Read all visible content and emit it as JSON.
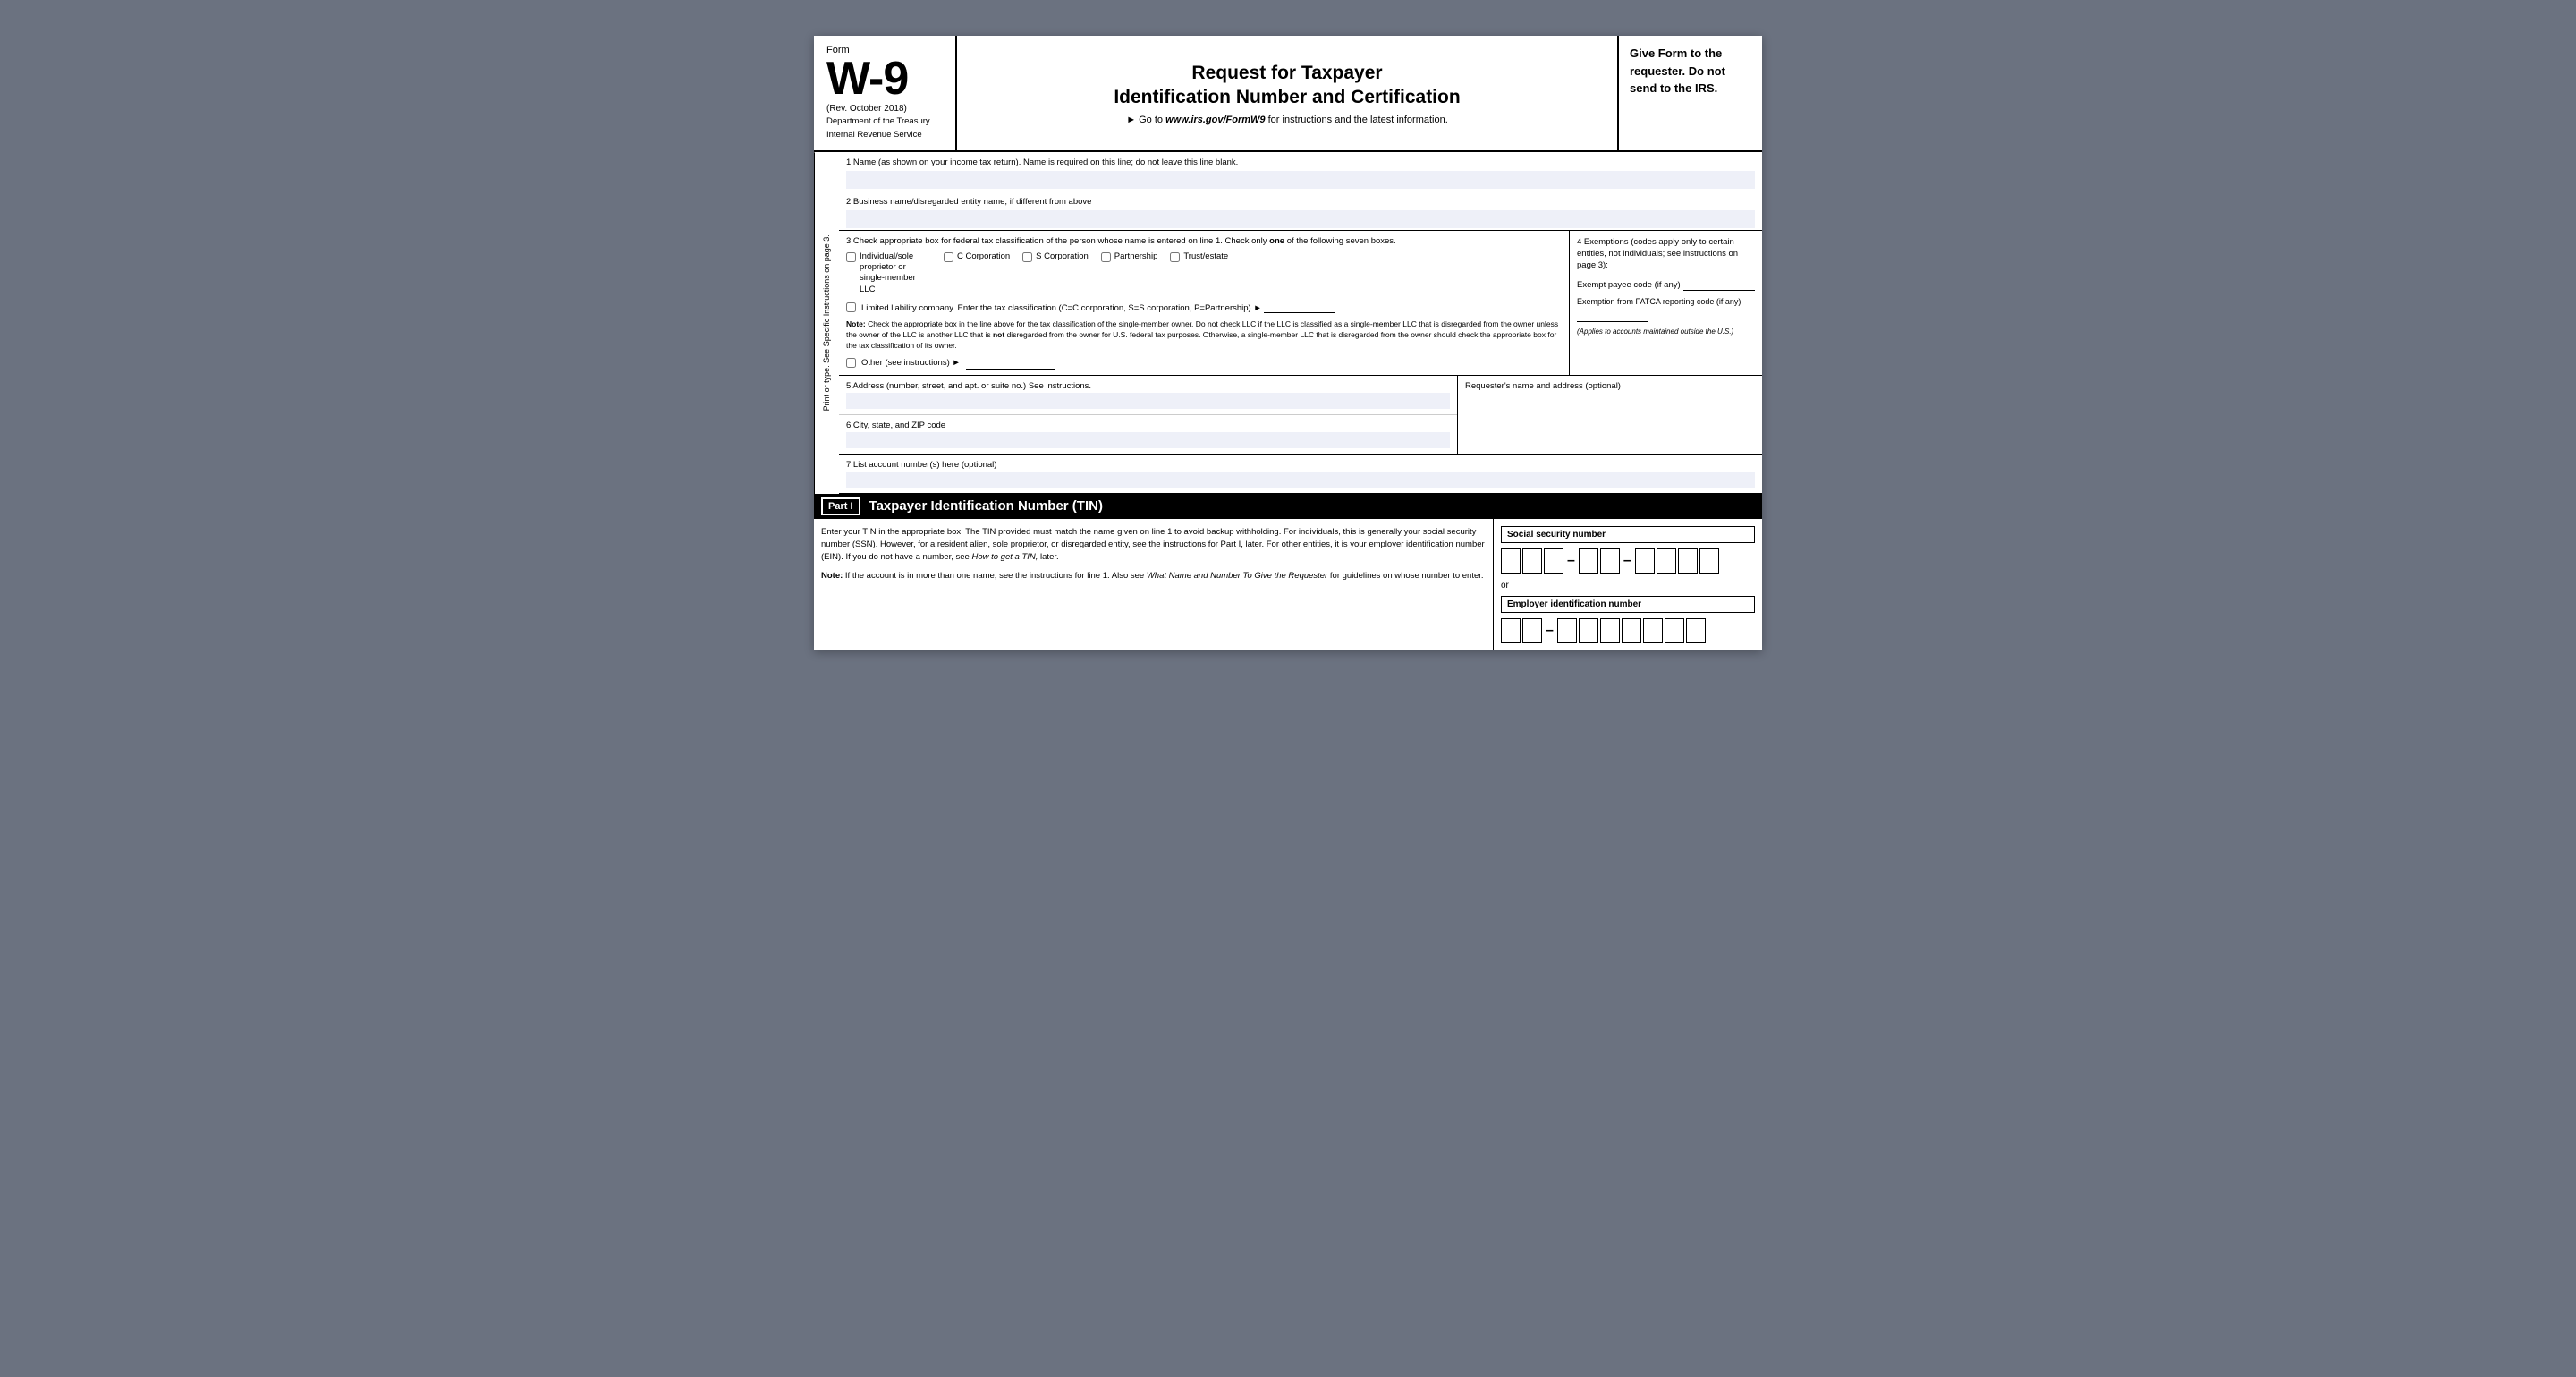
{
  "header": {
    "form_label": "Form",
    "form_number": "W-9",
    "rev": "(Rev. October 2018)",
    "dept1": "Department of the Treasury",
    "dept2": "Internal Revenue Service",
    "title_line1": "Request for Taxpayer",
    "title_line2": "Identification Number and Certification",
    "goto_text": "► Go to",
    "goto_url": "www.irs.gov/FormW9",
    "goto_suffix": "for instructions and the latest information.",
    "right_text_line1": "Give Form to the",
    "right_text_line2": "requester. Do not",
    "right_text_line3": "send to the IRS."
  },
  "sidebar": {
    "text": "Print or type.     See Specific Instructions on page 3."
  },
  "fields": {
    "field1_label": "1  Name (as shown on your income tax return). Name is required on this line; do not leave this line blank.",
    "field2_label": "2  Business name/disregarded entity name, if different from above",
    "field3_label": "3  Check appropriate box for federal tax classification of the person whose name is entered on line 1. Check only",
    "field3_label_bold": "one",
    "field3_label_end": "of the following seven boxes.",
    "check_individual": "Individual/sole proprietor or single-member LLC",
    "check_c_corp": "C Corporation",
    "check_s_corp": "S Corporation",
    "check_partnership": "Partnership",
    "check_trust": "Trust/estate",
    "llc_text1": "Limited liability company. Enter the tax classification (C=C corporation, S=S corporation, P=Partnership) ►",
    "note_label": "Note:",
    "note_text": " Check the appropriate box in the line above for the tax classification of the single-member owner.  Do not check LLC if the LLC is classified as a single-member LLC that is disregarded from the owner unless the owner of the LLC is another LLC that is",
    "note_not": "not",
    "note_text2": " disregarded from the owner for U.S. federal tax purposes. Otherwise, a single-member LLC that is disregarded from the owner should check the appropriate box for the tax classification of its owner.",
    "check_other": "Other (see instructions) ►",
    "exemptions_title": "4  Exemptions (codes apply only to certain entities, not individuals; see instructions on page 3):",
    "exempt_payee_label": "Exempt payee code (if any)",
    "fatca_label": "Exemption from FATCA reporting code (if any)",
    "applies_text": "(Applies to accounts maintained outside the U.S.)",
    "field5_label": "5  Address (number, street, and apt. or suite no.) See instructions.",
    "requester_label": "Requester's name and address (optional)",
    "field6_label": "6  City, state, and ZIP code",
    "field7_label": "7  List account number(s) here (optional)"
  },
  "part1": {
    "label": "Part I",
    "title": "Taxpayer Identification Number (TIN)",
    "body1": "Enter your TIN in the appropriate box. The TIN provided must match the name given on line 1 to avoid backup withholding. For individuals, this is generally your social security number (SSN). However, for a resident alien, sole proprietor, or disregarded entity, see the instructions for Part I, later. For other entities, it is your employer identification number (EIN). If you do not have a number, see",
    "body1_italic": "How to get a TIN,",
    "body1_end": " later.",
    "note_label": "Note:",
    "note2_text": " If the account is in more than one name, see the instructions for line 1. Also see",
    "note2_italic": "What Name and Number To Give the Requester",
    "note2_end": " for guidelines on whose number to enter.",
    "ssn_label": "Social security number",
    "or_text": "or",
    "ein_label": "Employer identification number",
    "ssn_group1_count": 3,
    "ssn_group2_count": 2,
    "ssn_group3_count": 4,
    "ein_group1_count": 2,
    "ein_group2_count": 7
  }
}
